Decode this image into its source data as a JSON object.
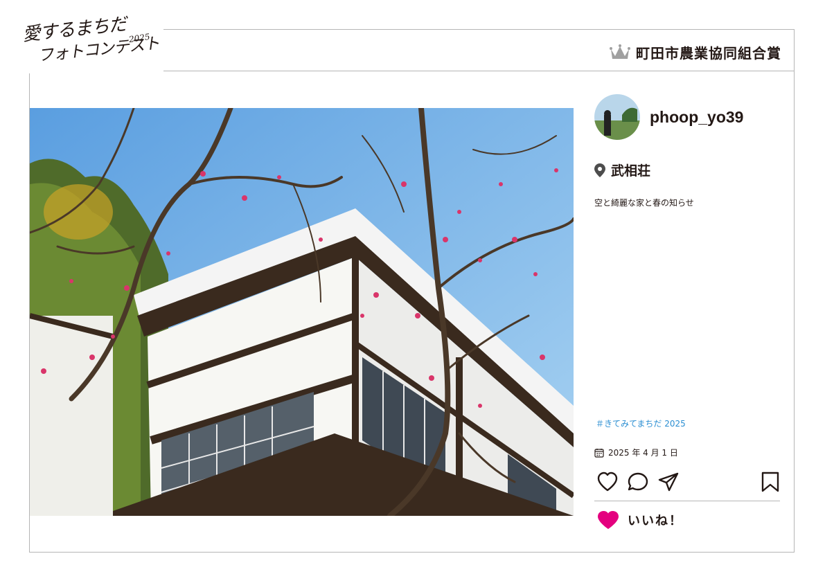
{
  "logo": {
    "line1": "愛するまちだ",
    "line2": "フォトコンテスト",
    "year": "2025"
  },
  "award": {
    "icon": "crown-icon",
    "title": "町田市農業協同組合賞",
    "icon_color": "#a0a0a0"
  },
  "post": {
    "username": "phoop_yo39",
    "location_icon": "location-pin-icon",
    "location": "武相荘",
    "caption": "空と綺麗な家と春の知らせ",
    "hashtag": "＃きてみてまちだ 2025",
    "date_icon": "calendar-icon",
    "date": "2025 年 4 月 1 日",
    "actions": [
      "heart-icon",
      "comment-icon",
      "share-icon",
      "bookmark-icon"
    ],
    "like_icon": "heart-filled-icon",
    "like_label": "いいね！",
    "like_color": "#e4007f",
    "hashtag_color": "#2a8ed2"
  }
}
